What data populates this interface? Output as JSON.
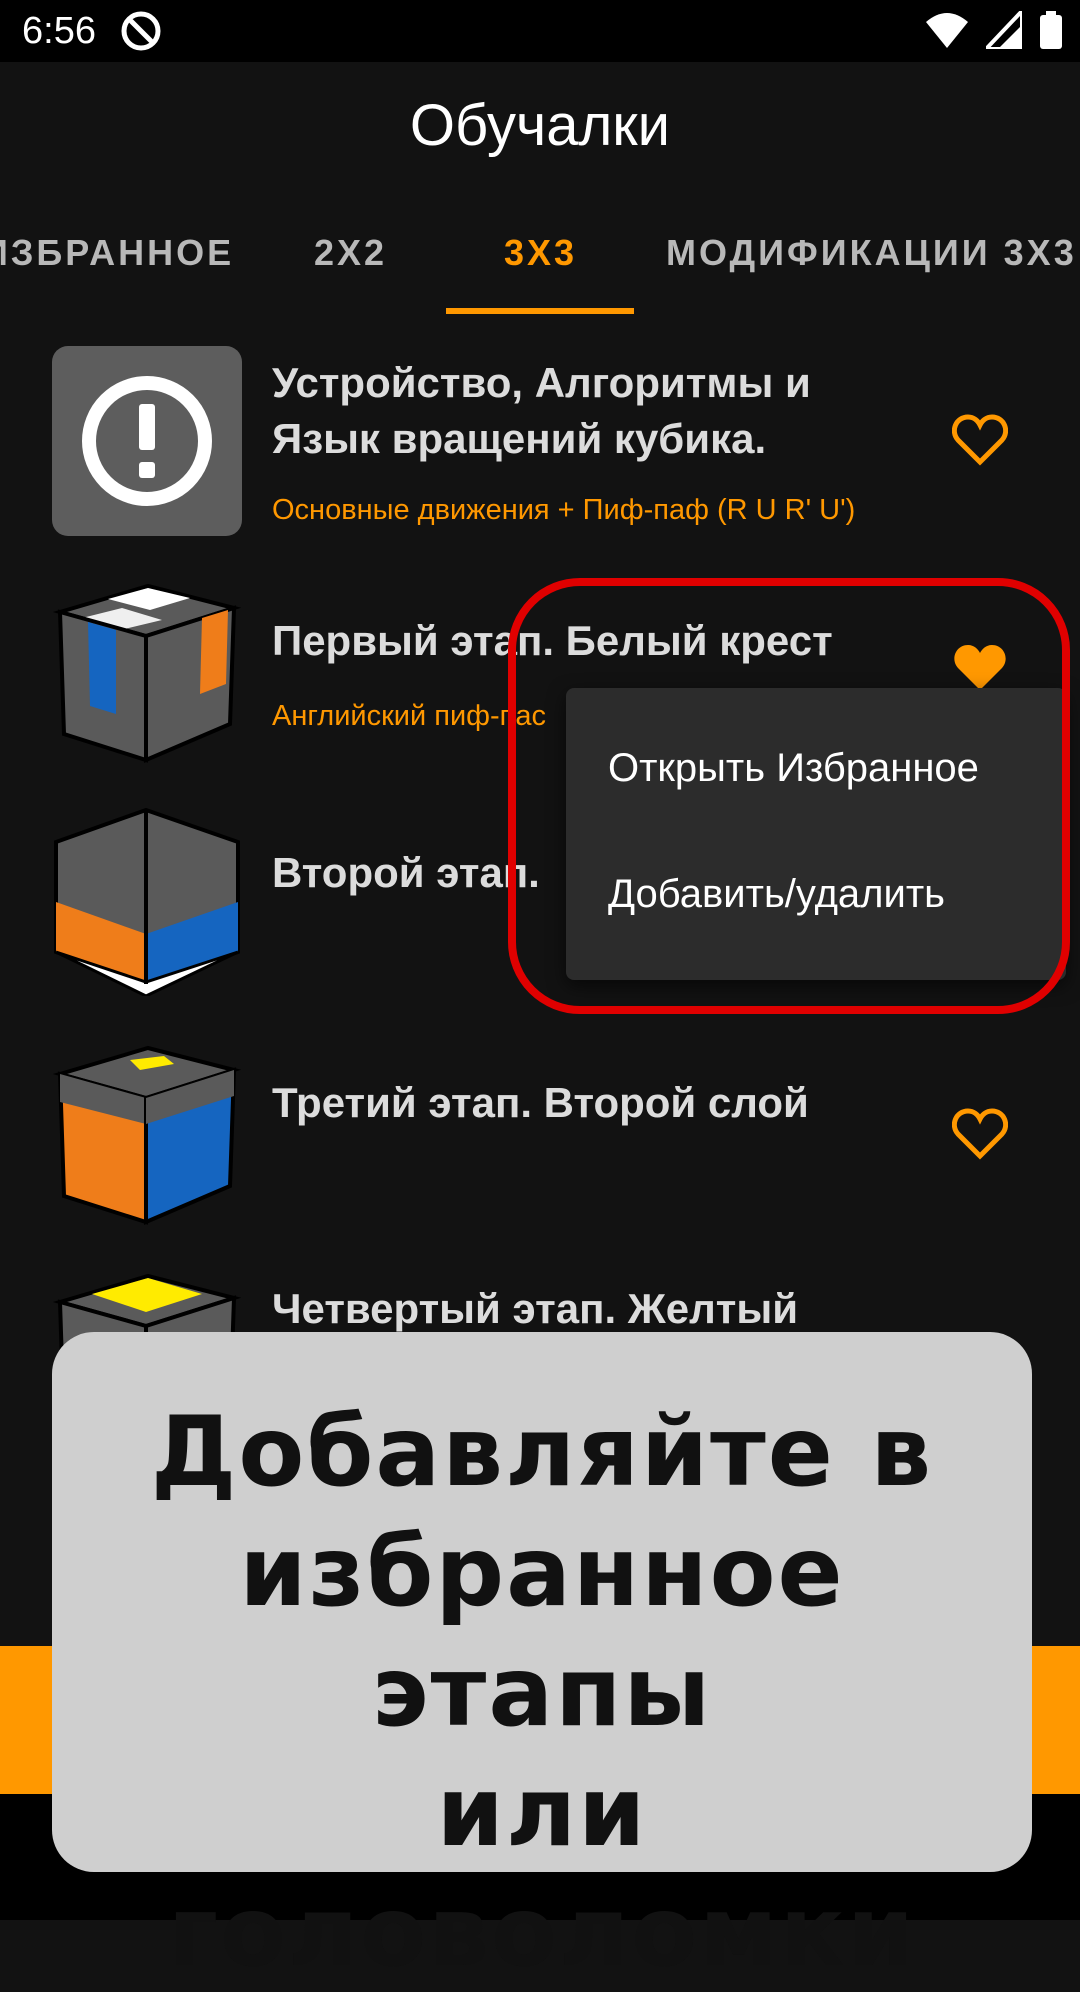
{
  "status": {
    "time": "6:56"
  },
  "header": {
    "title": "Обучалки"
  },
  "tabs": [
    {
      "label": "ИЗБРАННОЕ"
    },
    {
      "label": "2X2"
    },
    {
      "label": "3X3"
    },
    {
      "label": "МОДИФИКАЦИИ 3X3"
    }
  ],
  "items": [
    {
      "title_line1": "Устройство, Алгоритмы и",
      "title_line2": "Язык вращений кубика.",
      "subtitle": "Основные движения + Пиф-паф (R U R' U')",
      "favorite": false
    },
    {
      "title_line1": "Первый этап. Белый крест",
      "subtitle": "Английский пиф-пас",
      "favorite": true
    },
    {
      "title_line1": "Второй этап.",
      "favorite": false
    },
    {
      "title_line1": "Третий этап. Второй слой",
      "favorite": false
    },
    {
      "title_line1": "Четвертый этап. Желтый",
      "favorite": false
    }
  ],
  "menu": {
    "items": [
      {
        "label": "Открыть Избранное"
      },
      {
        "label": "Добавить/удалить"
      }
    ]
  },
  "promo": {
    "line1": "Добавляйте в",
    "line2": "избранное этапы",
    "line3": "или головоломки"
  },
  "colors": {
    "accent": "#ff9800",
    "highlight": "#e00000"
  }
}
